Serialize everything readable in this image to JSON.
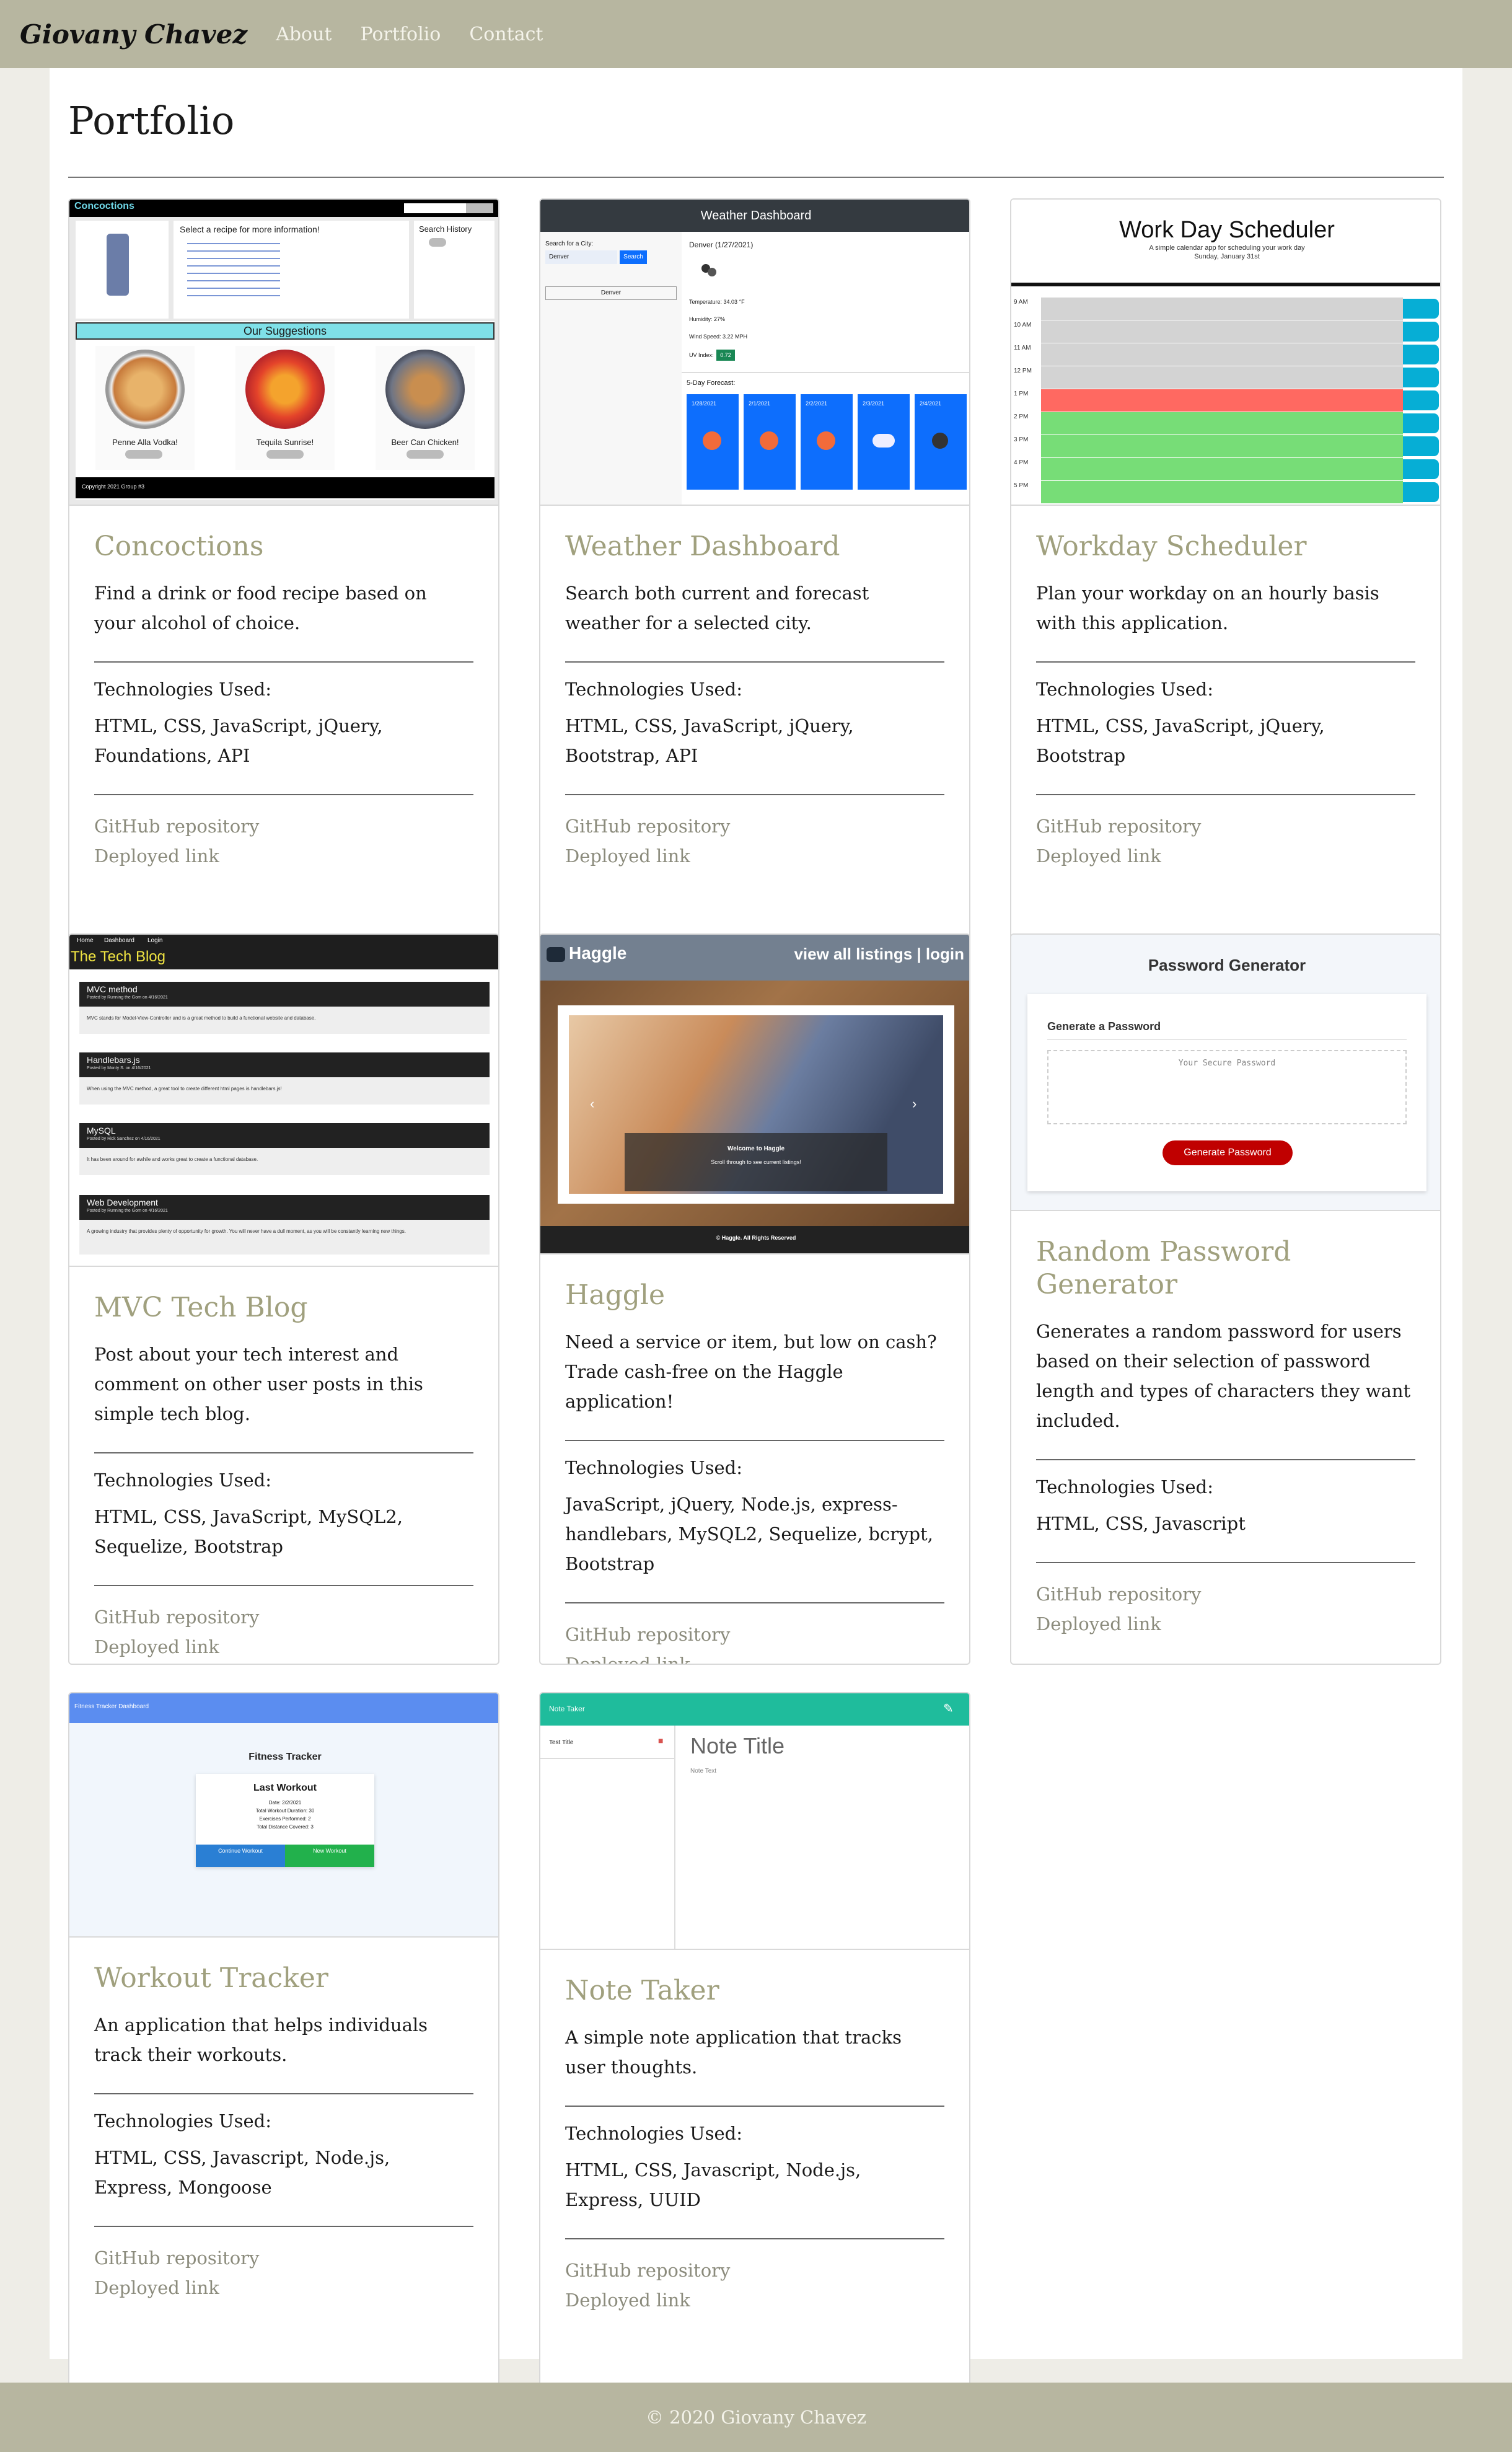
{
  "nav": {
    "brand": "Giovany Chavez",
    "links": [
      "About",
      "Portfolio",
      "Contact"
    ]
  },
  "page": {
    "title": "Portfolio"
  },
  "projects": [
    {
      "title": "Concoctions",
      "description": "Find a drink or food recipe based on your alcohol of choice.",
      "tech_label": "Technologies Used:",
      "tech": "HTML, CSS, JavaScript, jQuery, Foundations, API",
      "repo": "GitHub repository",
      "deploy": "Deployed link"
    },
    {
      "title": "Weather Dashboard",
      "description": "Search both current and forecast weather for a selected city.",
      "tech_label": "Technologies Used:",
      "tech": "HTML, CSS, JavaScript, jQuery, Bootstrap, API",
      "repo": "GitHub repository",
      "deploy": "Deployed link"
    },
    {
      "title": "Workday Scheduler",
      "description": "Plan your workday on an hourly basis with this application.",
      "tech_label": "Technologies Used:",
      "tech": "HTML, CSS, JavaScript, jQuery, Bootstrap",
      "repo": "GitHub repository",
      "deploy": "Deployed link"
    },
    {
      "title": "MVC Tech Blog",
      "description": "Post about your tech interest and comment on other user posts in this simple tech blog.",
      "tech_label": "Technologies Used:",
      "tech": "HTML, CSS, JavaScript, MySQL2, Sequelize, Bootstrap",
      "repo": "GitHub repository",
      "deploy": "Deployed link"
    },
    {
      "title": "Haggle",
      "description": "Need a service or item, but low on cash? Trade cash-free on the Haggle application!",
      "tech_label": "Technologies Used:",
      "tech": "JavaScript, jQuery, Node.js, express-handlebars, MySQL2, Sequelize, bcrypt, Bootstrap",
      "repo": "GitHub repository",
      "deploy": "Deployed link"
    },
    {
      "title": "Random Password Generator",
      "description": "Generates a random password for users based on their selection of password length and types of characters they want included.",
      "tech_label": "Technologies Used:",
      "tech": "HTML, CSS, Javascript",
      "repo": "GitHub repository",
      "deploy": "Deployed link"
    },
    {
      "title": "Workout Tracker",
      "description": "An application that helps individuals track their workouts.",
      "tech_label": "Technologies Used:",
      "tech": "HTML, CSS, Javascript, Node.js, Express, Mongoose",
      "repo": "GitHub repository",
      "deploy": "Deployed link"
    },
    {
      "title": "Note Taker",
      "description": "A simple note application that tracks user thoughts.",
      "tech_label": "Technologies Used:",
      "tech": "HTML, CSS, Javascript, Node.js, Express, UUID",
      "repo": "GitHub repository",
      "deploy": "Deployed link"
    }
  ],
  "thumbs": {
    "concoctions": {
      "logo": "Concoctions",
      "prompt": "Select a recipe for more information!",
      "history": "Search History",
      "suggestions": "Our Suggestions",
      "items": [
        "Penne Alla Vodka!",
        "Tequila Sunrise!",
        "Beer Can Chicken!"
      ],
      "copyright": "Copyright 2021 Group #3"
    },
    "weather": {
      "header": "Weather Dashboard",
      "search_label": "Search for a City:",
      "input": "Denver",
      "button": "Search",
      "history": "Denver",
      "city": "Denver (1/27/2021)",
      "temp": "Temperature: 34.03 °F",
      "humidity": "Humidity: 27%",
      "wind": "Wind Speed: 3.22 MPH",
      "uv_label": "UV Index:",
      "uv": "0.72",
      "forecast": "5-Day Forecast:",
      "days": [
        "1/28/2021",
        "2/1/2021",
        "2/2/2021",
        "2/3/2021",
        "2/4/2021"
      ]
    },
    "scheduler": {
      "title": "Work Day Scheduler",
      "subtitle": "A simple calendar app for scheduling your work day",
      "date": "Sunday, January 31st",
      "hours": [
        "9 AM",
        "10 AM",
        "11 AM",
        "12 PM",
        "1 PM",
        "2 PM",
        "3 PM",
        "4 PM",
        "5 PM"
      ]
    },
    "blog": {
      "nav": [
        "Home",
        "Dashboard",
        "Login"
      ],
      "title": "The Tech Blog",
      "posts": [
        {
          "title": "MVC method",
          "meta": "Posted by Running the Gom on 4/16/2021",
          "body": "MVC stands for Model-View-Controller and is a great method to build a functional website and database."
        },
        {
          "title": "Handlebars.js",
          "meta": "Posted by Monty S. on 4/16/2021",
          "body": "When using the MVC method, a great tool to create different html pages is handlebars.js!"
        },
        {
          "title": "MySQL",
          "meta": "Posted by Rick Sanchez on 4/16/2021",
          "body": "It has been around for awhile and works great to create a functional database."
        },
        {
          "title": "Web Development",
          "meta": "Posted by Running the Gom on 4/16/2021",
          "body": "A growing industry that provides plenty of opportunity for growth. You will never have a dull moment, as you will be constantly learning new things."
        }
      ]
    },
    "haggle": {
      "logo": "Haggle",
      "nav": "view all listings | login",
      "welcome": "Welcome to Haggle",
      "scroll": "Scroll through to see current listings!",
      "footer": "© Haggle. All Rights Reserved"
    },
    "password": {
      "title": "Password Generator",
      "subtitle": "Generate a Password",
      "placeholder": "Your Secure Password",
      "button": "Generate Password"
    },
    "workout": {
      "bar": "Fitness Tracker Dashboard",
      "title": "Fitness Tracker",
      "card_title": "Last Workout",
      "lines": [
        "Date: 2/2/2021",
        "Total Workout Duration: 30",
        "Exercises Performed: 2",
        "Total Distance Covered: 3"
      ],
      "btn1": "Continue Workout",
      "btn2": "New Workout"
    },
    "notes": {
      "bar": "Note Taker",
      "item": "Test Title",
      "title": "Note Title",
      "text": "Note Text"
    }
  },
  "footer": {
    "text": "© 2020 Giovany Chavez"
  },
  "colors": {
    "navbar": "#b7b6a0",
    "accent_title": "#a0a07e",
    "link": "#8b8b7c",
    "background": "#eeede7"
  }
}
